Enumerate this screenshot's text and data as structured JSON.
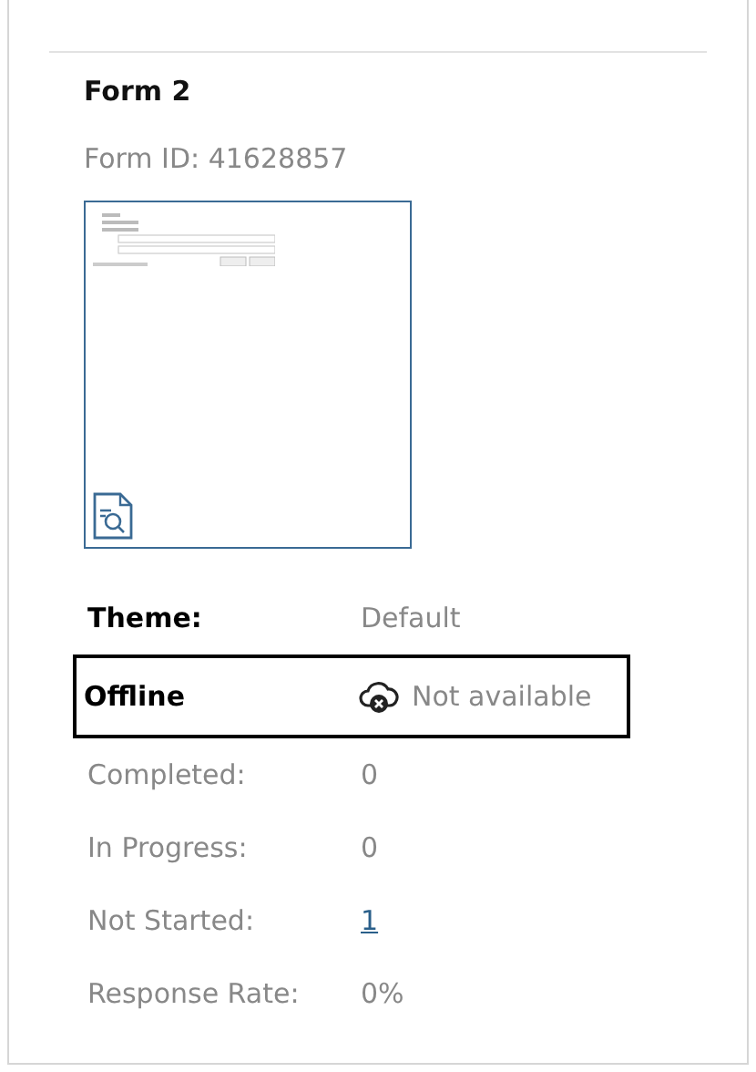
{
  "form": {
    "title": "Form 2",
    "form_id": "Form ID: 41628857"
  },
  "fields": [
    {
      "label": "Theme:",
      "value": "Default",
      "kind": "text",
      "strong": true,
      "focused": false
    },
    {
      "label": "Offline",
      "value": "Not available",
      "kind": "status",
      "strong": true,
      "focused": true
    },
    {
      "label": "Completed:",
      "value": "0",
      "kind": "text",
      "strong": false,
      "focused": false
    },
    {
      "label": "In Progress:",
      "value": "0",
      "kind": "text",
      "strong": false,
      "focused": false
    },
    {
      "label": "Not Started:",
      "value": "1",
      "kind": "link",
      "strong": false,
      "focused": false
    },
    {
      "label": "Response Rate:",
      "value": "0%",
      "kind": "text",
      "strong": false,
      "focused": false
    }
  ]
}
